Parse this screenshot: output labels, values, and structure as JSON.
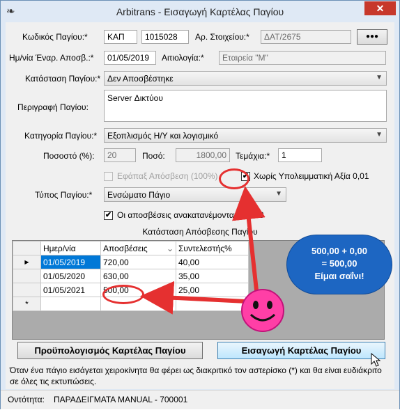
{
  "window": {
    "title": "Arbitrans - Εισαγωγή Καρτέλας Παγίου",
    "close_symbol": "✕",
    "app_icon": "bird-icon"
  },
  "form": {
    "asset_code_label": "Κωδικός Παγίου:*",
    "asset_code_prefix": "ΚΑΠ",
    "asset_code_number": "1015028",
    "item_number_label": "Αρ. Στοιχείου:*",
    "item_number_value": "ΔΑΤ/2675",
    "more_button": "●●●",
    "start_date_label": "Ημ/νία Έναρ. Αποσβ.:*",
    "start_date_value": "01/05/2019",
    "cause_label": "Αιτιολογία:*",
    "cause_value": "Εταιρεία \"Μ\"",
    "status_label": "Κατάσταση Παγίου:*",
    "status_value": "Δεν Αποσβέστηκε",
    "description_label": "Περιγραφή Παγίου:",
    "description_value": "Server Δικτύου",
    "category_label": "Κατηγορία Παγίου:*",
    "category_value": "Εξοπλισμός Η/Υ και λογισμικό",
    "percent_label": "Ποσοστό (%):",
    "percent_value": "20",
    "amount_label": "Ποσό:",
    "amount_value": "1800,00",
    "pieces_label": "Τεμάχια:*",
    "pieces_value": "1",
    "one_off_label": "Εφάπαξ Απόσβεση (100%)",
    "one_off_checked": false,
    "no_residual_label": "Χωρίς Υπολειμματική Αξία 0,01",
    "no_residual_checked": true,
    "type_label": "Τύπος Παγίου:*",
    "type_value": "Ενσώματο Πάγιο",
    "redistributed_label": "Οι αποσβέσεις ανακατανέμονται στο Ε3",
    "redistributed_checked": true,
    "check_mark": "✔",
    "grid_title": "Κατάσταση Απόσβεσης Παγίου"
  },
  "grid": {
    "columns": [
      "Ημερ/νία",
      "Αποσβέσεις",
      "Συντελεστής%"
    ],
    "sort_indicator": "⌄",
    "current_row_marker": "▶",
    "new_row_marker": "*",
    "rows": [
      [
        "01/05/2019",
        "720,00",
        "40,00"
      ],
      [
        "01/05/2020",
        "630,00",
        "35,00"
      ],
      [
        "01/05/2021",
        "500,00",
        "25,00"
      ]
    ]
  },
  "buttons": {
    "budget": "Προϋπολογισμός Καρτέλας Παγίου",
    "insert": "Εισαγωγή Καρτέλας Παγίου"
  },
  "note": "Όταν ένα πάγιο εισάγεται χειροκίνητα θα φέρει ως διακριτικό τον αστερίσκο (*) και θα είναι ευδιάκριτο σε όλες τις εκτυπώσεις.",
  "status_bar": {
    "label": "Οντότητα:",
    "value": "ΠΑΡΑΔΕΙΓΜΑΤΑ MANUAL  -  700001"
  },
  "annotation": {
    "bubble_line1": "500,00 + 0,00",
    "bubble_line2": "= 500,00",
    "bubble_line3": "Είμαι σαΐνι!",
    "smiley_icon": "smiley-face-icon",
    "colors": {
      "arrow": "#e53030",
      "bubble": "#1d66c2",
      "smiley": "#ff3fa6"
    }
  }
}
